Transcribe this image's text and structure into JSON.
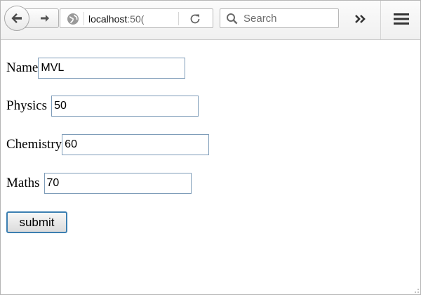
{
  "browser": {
    "url_host": "localhost",
    "url_port_visible": ":50(",
    "search_placeholder": "Search",
    "icons": {
      "back": "back-arrow-icon",
      "forward": "forward-arrow-icon",
      "site": "globe-icon",
      "reload": "reload-icon",
      "search": "search-icon",
      "overflow": "double-chevron-icon",
      "menu": "hamburger-menu-icon"
    }
  },
  "form": {
    "fields": [
      {
        "label": "Name",
        "value": "MVL"
      },
      {
        "label": "Physics",
        "value": "50"
      },
      {
        "label": "Chemistry",
        "value": "60"
      },
      {
        "label": "Maths",
        "value": "70"
      }
    ],
    "submit_label": "submit"
  },
  "colors": {
    "field_border": "#7f9db9",
    "focus_button_border": "#3c7fb1"
  }
}
